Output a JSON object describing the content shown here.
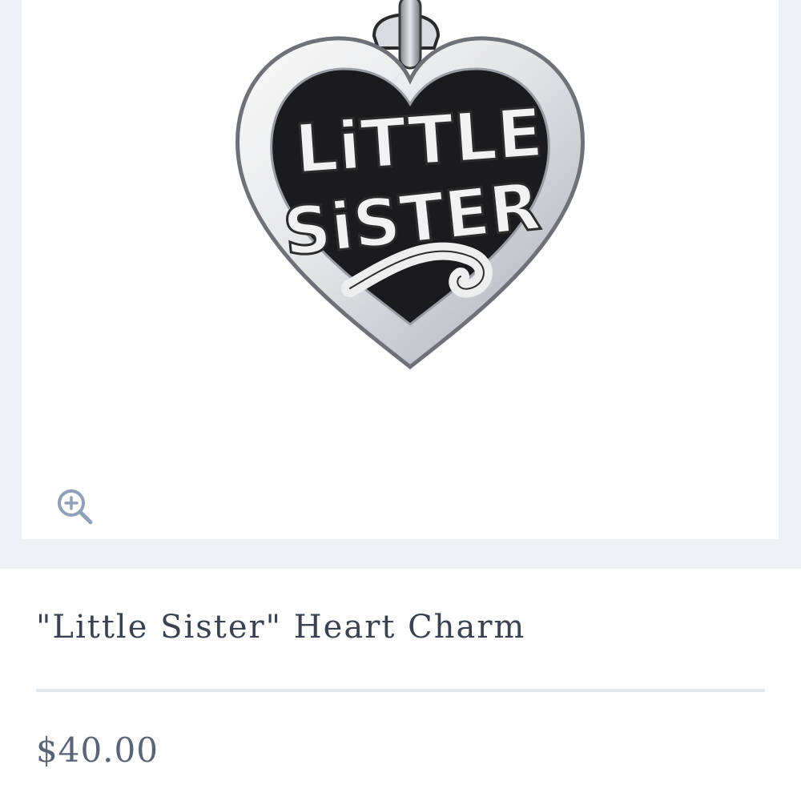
{
  "product": {
    "image_engraving": [
      "LiTTLE",
      "SiSTER"
    ],
    "title": "\"Little Sister\" Heart Charm",
    "price": "$40.00"
  },
  "icons": {
    "zoom": "zoom-in-icon"
  },
  "colors": {
    "page_background": "#eef2f7",
    "card_background": "#ffffff",
    "title_text": "#3a4150",
    "price_text": "#5a6476",
    "divider": "#e3e9f1",
    "zoom_icon": "#8fa0b8",
    "silver": "#c9ccd1"
  }
}
